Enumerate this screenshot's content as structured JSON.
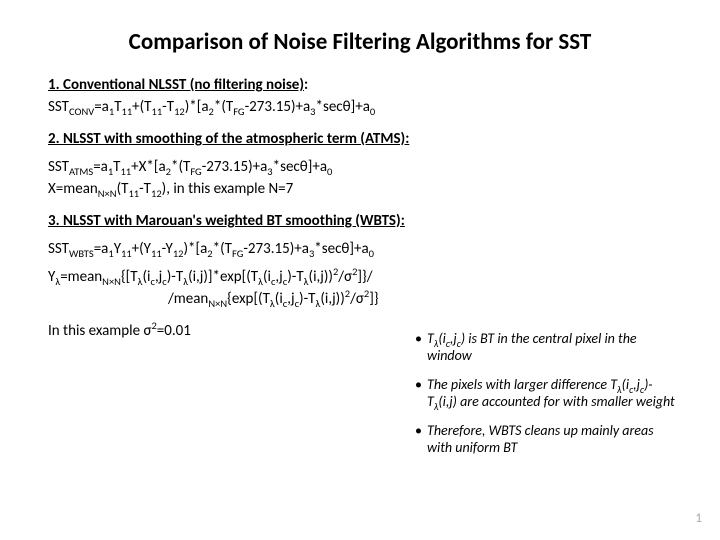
{
  "title": "Comparison of Noise Filtering Algorithms for SST",
  "section1": {
    "heading": "1. Conventional NLSST (no filtering noise)",
    "colon": ":"
  },
  "section2": {
    "heading": "2. NLSST with smoothing of the atmospheric term (ATMS):"
  },
  "section3": {
    "heading": "3. NLSST with Marouan's weighted BT smoothing (WBTS):"
  },
  "expl": ", in this example N=7",
  "sigma_note1": "In this example σ",
  "sigma_note2": "=0.01",
  "notes": {
    "n1a": "T",
    "n1b": "(i",
    "n1c": ",j",
    "n1d": ") is BT in the central pixel in the window",
    "n2a": "The pixels with larger difference T",
    "n2b": "(i",
    "n2c": ",j",
    "n2d": ")-T",
    "n2e": "(i,j) are accounted for with smaller weight",
    "n3": "Therefore, WBTS cleans up mainly areas with uniform BT"
  },
  "page": "1",
  "sym": {
    "lambda": "λ",
    "c": "c",
    "times": "×"
  },
  "txt": {
    "sst": "SST",
    "conv": "CONV",
    "atms": "ATMS",
    "wbts": "WBTS",
    "eq": "=a",
    "one": "1",
    "T": "T",
    "eleven": "11",
    "plus_open": "+(T",
    "minus_t": "-T",
    "twelve": "12",
    "close_star": ")*[a",
    "two": "2",
    "star_t": "*(T",
    "fg": "FG",
    "minus_const": "-273.15)+a",
    "three": "3",
    "sec": "*secθ]+a",
    "zero": "0",
    "plusX": "+X*[a",
    "Xeq": "X=mean",
    "NxN": "N×N",
    "open_t": "(T",
    "close_p": ")",
    "Y": "Y",
    "plus_openY": "+(Y",
    "minus_y": "-Y",
    "Yl_eq": "=mean",
    "brace_open": "{[T",
    "i_open": "(i",
    "j_open": ",j",
    "close_minus_t": ")-T",
    "ij": "(i,j)]*exp[(T",
    "ij2": "(i,j))",
    "over_sigma": "/σ",
    "close_br": "]}/",
    "slash_mean": "/mean",
    "exp_open": "{exp[(T",
    "close_br2": "]}"
  }
}
